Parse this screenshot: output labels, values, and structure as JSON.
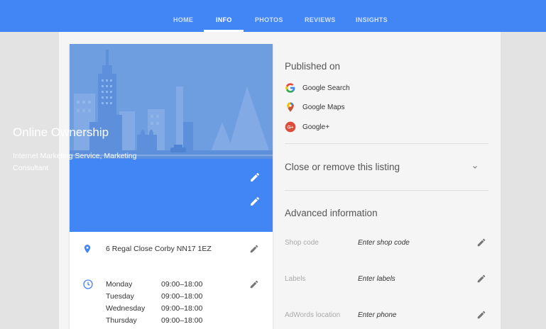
{
  "nav": {
    "tabs": [
      {
        "label": "HOME",
        "active": false
      },
      {
        "label": "INFO",
        "active": true
      },
      {
        "label": "PHOTOS",
        "active": false
      },
      {
        "label": "REVIEWS",
        "active": false
      },
      {
        "label": "INSIGHTS",
        "active": false
      }
    ]
  },
  "business": {
    "name": "Online Ownership",
    "category": "Internet Marketing Service, Marketing Consultant",
    "address": "6 Regal Close Corby NN17 1EZ",
    "hours": [
      {
        "day": "Monday",
        "time": "09:00–18:00"
      },
      {
        "day": "Tuesday",
        "time": "09:00–18:00"
      },
      {
        "day": "Wednesday",
        "time": "09:00–18:00"
      },
      {
        "day": "Thursday",
        "time": "09:00–18:00"
      }
    ]
  },
  "published": {
    "title": "Published on",
    "items": [
      {
        "label": "Google Search",
        "icon": "google-g-icon"
      },
      {
        "label": "Google Maps",
        "icon": "google-maps-icon"
      },
      {
        "label": "Google+",
        "icon": "google-plus-icon"
      }
    ]
  },
  "close_listing": {
    "title": "Close or remove this listing"
  },
  "advanced": {
    "title": "Advanced information",
    "fields": [
      {
        "label": "Shop code",
        "value": "Enter shop code"
      },
      {
        "label": "Labels",
        "value": "Enter labels"
      },
      {
        "label": "AdWords location",
        "value": "Enter phone"
      }
    ]
  },
  "colors": {
    "brand_blue": "#4285f4",
    "hero_blue": "#6f9ee0",
    "pin_blue": "#4285f4"
  }
}
